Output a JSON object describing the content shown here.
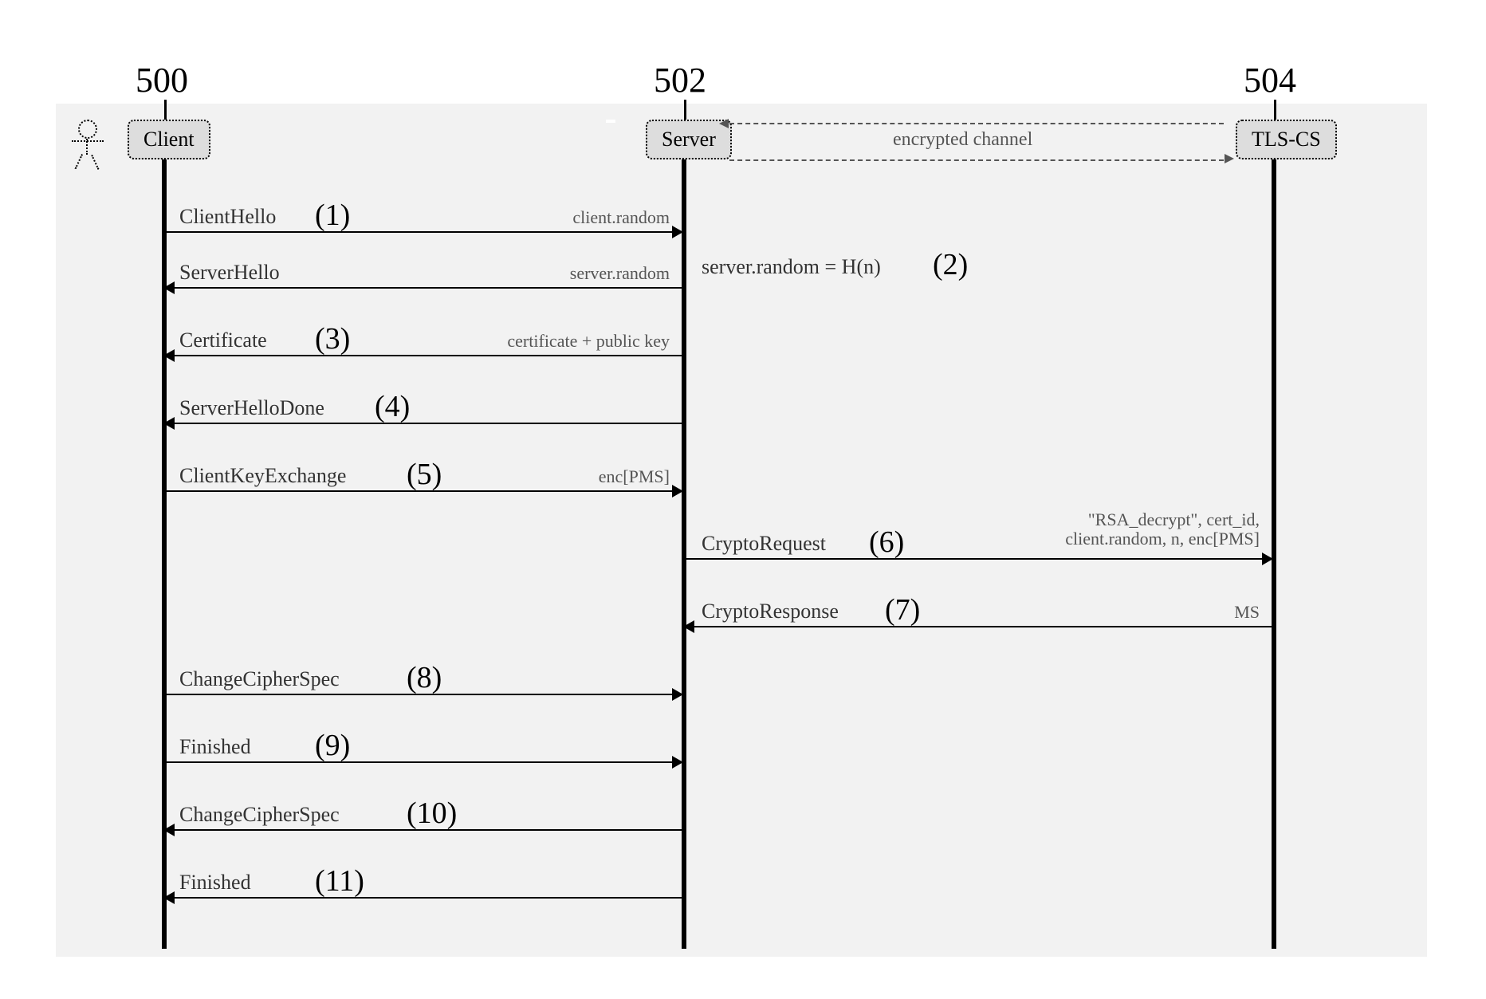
{
  "participants": {
    "client": {
      "label": "Client",
      "number": "500"
    },
    "server": {
      "label": "Server",
      "number": "502"
    },
    "tlscs": {
      "label": "TLS-CS",
      "number": "504"
    }
  },
  "channel_label": "encrypted channel",
  "annotations": {
    "server_random": "server.random = H(n)"
  },
  "steps": {
    "s1": {
      "label": "ClientHello",
      "num": "(1)",
      "payload": "client.random"
    },
    "s2": {
      "label": "ServerHello",
      "num": "(2)",
      "payload": "server.random"
    },
    "s3": {
      "label": "Certificate",
      "num": "(3)",
      "payload": "certificate + public key"
    },
    "s4": {
      "label": "ServerHelloDone",
      "num": "(4)",
      "payload": ""
    },
    "s5": {
      "label": "ClientKeyExchange",
      "num": "(5)",
      "payload": "enc[PMS]"
    },
    "s6": {
      "label": "CryptoRequest",
      "num": "(6)",
      "payload": "\"RSA_decrypt\", cert_id,\nclient.random, n, enc[PMS]"
    },
    "s7": {
      "label": "CryptoResponse",
      "num": "(7)",
      "payload": "MS"
    },
    "s8": {
      "label": "ChangeCipherSpec",
      "num": "(8)",
      "payload": ""
    },
    "s9": {
      "label": "Finished",
      "num": "(9)",
      "payload": ""
    },
    "s10": {
      "label": "ChangeCipherSpec",
      "num": "(10)",
      "payload": ""
    },
    "s11": {
      "label": "Finished",
      "num": "(11)",
      "payload": ""
    }
  },
  "credit": ""
}
